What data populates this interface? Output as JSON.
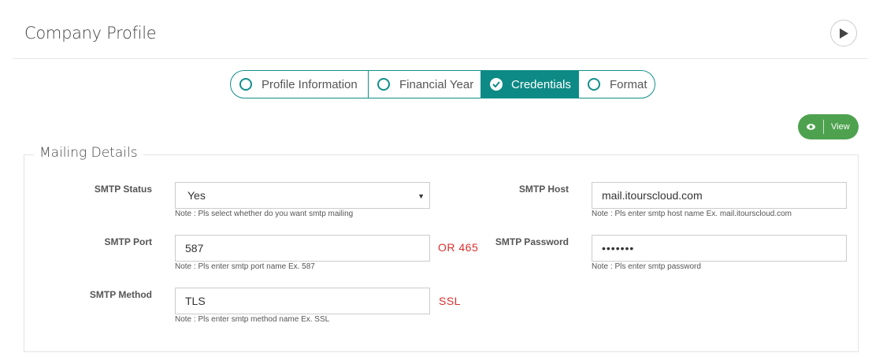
{
  "header": {
    "title": "Company Profile",
    "play_icon": "play-icon"
  },
  "tabs": [
    {
      "label": "Profile Information",
      "state": "unselected"
    },
    {
      "label": "Financial Year",
      "state": "unselected"
    },
    {
      "label": "Credentials",
      "state": "active"
    },
    {
      "label": "Format",
      "state": "unselected"
    }
  ],
  "view_button": {
    "label": "View",
    "icon": "eye-icon"
  },
  "section": {
    "legend": "Mailing Details"
  },
  "fields": {
    "smtp_status": {
      "label": "SMTP Status",
      "value": "Yes",
      "note": "Note : Pls select whether do you want smtp mailing"
    },
    "smtp_host": {
      "label": "SMTP Host",
      "value": "mail.itourscloud.com",
      "note": "Note : Pls enter smtp host name Ex. mail.itourscloud.com"
    },
    "smtp_port": {
      "label": "SMTP Port",
      "value": "587",
      "note": "Note : Pls enter smtp port name Ex. 587",
      "annotation": "OR 465"
    },
    "smtp_password": {
      "label": "SMTP Password",
      "value": "•••••••",
      "note": "Note : Pls enter smtp password"
    },
    "smtp_method": {
      "label": "SMTP Method",
      "value": "TLS",
      "note": "Note : Pls enter smtp method name Ex. SSL",
      "annotation": "SSL"
    }
  },
  "colors": {
    "accent": "#0d8a85",
    "view_button": "#4ea24f",
    "annotation": "#d9302c"
  }
}
